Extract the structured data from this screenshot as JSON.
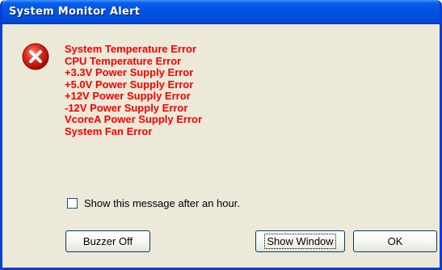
{
  "window": {
    "title": "System Monitor Alert"
  },
  "alert": {
    "icon": "error-icon",
    "errors": [
      "System Temperature Error",
      "CPU Temperature Error",
      "+3.3V Power Supply Error",
      "+5.0V Power Supply Error",
      "+12V Power Supply Error",
      "-12V Power Supply Error",
      "VcoreA Power Supply Error",
      "System Fan Error"
    ],
    "error_color": "#ff0000"
  },
  "options": {
    "show_later_label": "Show this message after an hour.",
    "show_later_checked": false
  },
  "buttons": {
    "buzzer_off": "Buzzer Off",
    "show_window": "Show Window",
    "ok": "OK"
  },
  "colors": {
    "titlebar": "#0153e3",
    "window_face": "#ece9d8"
  }
}
